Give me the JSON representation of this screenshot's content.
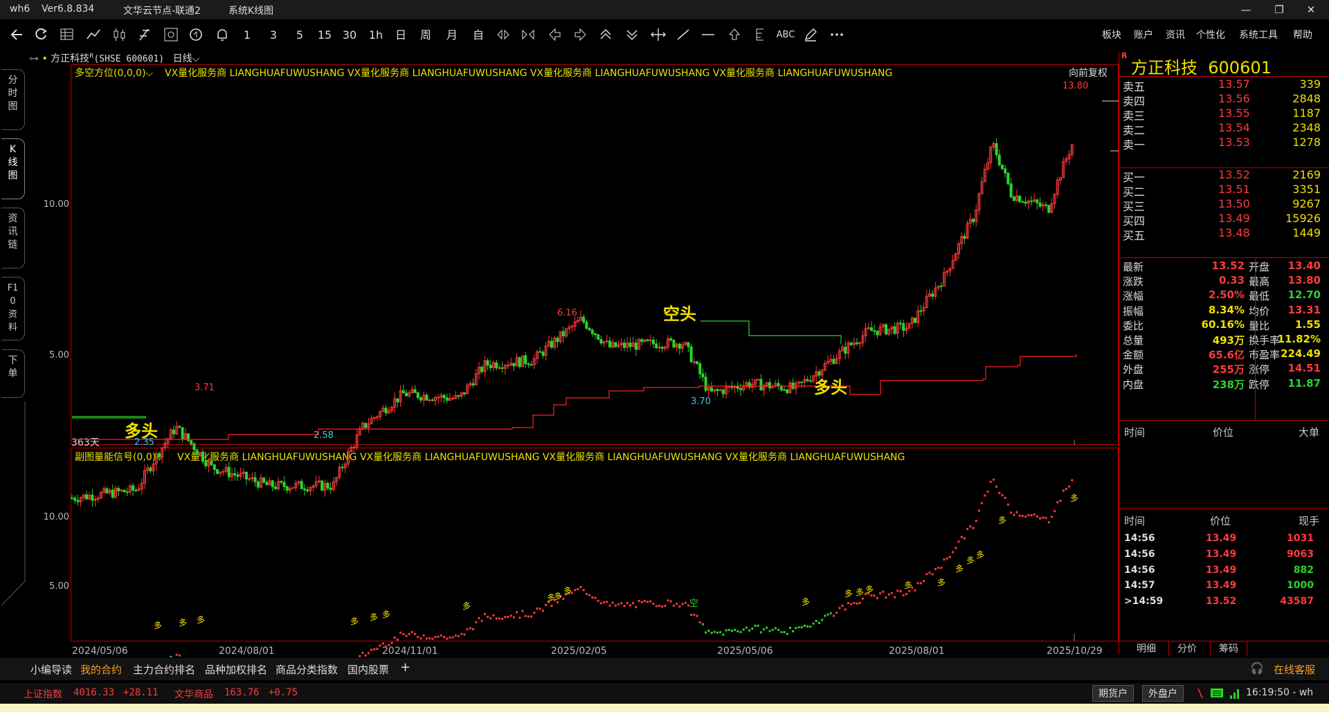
{
  "titlebar": {
    "app": "wh6",
    "version": "Ver6.8.834",
    "server": "文华云节点-联通2",
    "view": "系统K线图",
    "minimize": "—",
    "restore": "❐",
    "close": "✕"
  },
  "toolbar": {
    "periods": [
      "1",
      "3",
      "5",
      "15",
      "30",
      "1h",
      "日",
      "周",
      "月",
      "自"
    ],
    "menu": [
      "板块",
      "账户",
      "资讯",
      "个性化",
      "系统工具",
      "帮助"
    ],
    "abc": "ABC"
  },
  "left_tabs": [
    "分时图",
    "K线图",
    "资讯链",
    "F10资料",
    "下单"
  ],
  "chart_header": {
    "name": "方正科技",
    "r_mark": "R",
    "code": "(SHSE 600601)",
    "period": "日线",
    "adjust": "向前复权"
  },
  "main_indicator": {
    "title": "多空方位(0,0,0)",
    "ad": "VX量化服务商  LIANGHUAFUWUSHANG  VX量化服务商  LIANGHUAFUWUSHANG  VX量化服务商  LIANGHUAFUWUSHANG  VX量化服务商  LIANGHUAFUWUSHANG",
    "days": "363天",
    "label_short": "空头",
    "label_long1": "多头",
    "label_long2": "多头"
  },
  "sub_indicator": {
    "title": "副图量能信号(0,0)",
    "ad": "VX量化服务商  LIANGHUAFUWUSHANG  VX量化服务商  LIANGHUAFUWUSHANG  VX量化服务商  LIANGHUAFUWUSHANG  VX量化服务商  LIANGHUAFUWUSHANG",
    "signal_long": "多",
    "signal_short": "空"
  },
  "chart_data": {
    "type": "candlestick",
    "x_ticks": [
      "2024/05/06",
      "2024/08/01",
      "2024/11/01",
      "2025/02/05",
      "2025/05/06",
      "2025/08/01",
      "2025/10/29"
    ],
    "main_y_ticks": [
      "10.00",
      "5.00"
    ],
    "sub_y_ticks": [
      "10.00",
      "5.00"
    ],
    "annotations": [
      "13.80",
      "6.16",
      "3.71",
      "3.70",
      "2.58",
      "2.35"
    ],
    "close_path": [
      [
        "2024/05/06",
        2.6
      ],
      [
        "2024/06/10",
        2.7
      ],
      [
        "2024/07/01",
        3.6
      ],
      [
        "2024/07/20",
        3.0
      ],
      [
        "2024/08/20",
        2.75
      ],
      [
        "2024/09/24",
        2.75
      ],
      [
        "2024/10/10",
        3.6
      ],
      [
        "2024/11/01",
        4.2
      ],
      [
        "2024/12/01",
        4.1
      ],
      [
        "2024/12/15",
        4.8
      ],
      [
        "2025/01/10",
        4.9
      ],
      [
        "2025/02/05",
        5.9
      ],
      [
        "2025/02/20",
        5.2
      ],
      [
        "2025/03/20",
        5.3
      ],
      [
        "2025/04/01",
        5.3
      ],
      [
        "2025/04/15",
        4.2
      ],
      [
        "2025/05/06",
        4.4
      ],
      [
        "2025/06/01",
        4.3
      ],
      [
        "2025/06/20",
        4.9
      ],
      [
        "2025/07/10",
        5.6
      ],
      [
        "2025/08/01",
        5.7
      ],
      [
        "2025/08/20",
        7.2
      ],
      [
        "2025/09/05",
        9.5
      ],
      [
        "2025/09/15",
        13.2
      ],
      [
        "2025/09/25",
        10.5
      ],
      [
        "2025/10/15",
        9.8
      ],
      [
        "2025/10/29",
        13.52
      ]
    ]
  },
  "quote": {
    "name": "方正科技",
    "code": "600601",
    "asks": [
      {
        "label": "卖五",
        "price": "13.57",
        "vol": "339"
      },
      {
        "label": "卖四",
        "price": "13.56",
        "vol": "2848"
      },
      {
        "label": "卖三",
        "price": "13.55",
        "vol": "1187"
      },
      {
        "label": "卖二",
        "price": "13.54",
        "vol": "2348"
      },
      {
        "label": "卖一",
        "price": "13.53",
        "vol": "1278"
      }
    ],
    "bids": [
      {
        "label": "买一",
        "price": "13.52",
        "vol": "2169"
      },
      {
        "label": "买二",
        "price": "13.51",
        "vol": "3351"
      },
      {
        "label": "买三",
        "price": "13.50",
        "vol": "9267"
      },
      {
        "label": "买四",
        "price": "13.49",
        "vol": "15926"
      },
      {
        "label": "买五",
        "price": "13.48",
        "vol": "1449"
      }
    ],
    "stats": [
      {
        "l1": "最新",
        "v1": "13.52",
        "c1": "#ff3b3b",
        "l2": "开盘",
        "v2": "13.40",
        "c2": "#ff3b3b"
      },
      {
        "l1": "涨跌",
        "v1": "0.33",
        "c1": "#ff3b3b",
        "l2": "最高",
        "v2": "13.80",
        "c2": "#ff3b3b"
      },
      {
        "l1": "涨幅",
        "v1": "2.50%",
        "c1": "#ff3b3b",
        "l2": "最低",
        "v2": "12.70",
        "c2": "#2bd42b"
      },
      {
        "l1": "振幅",
        "v1": "8.34%",
        "c1": "#f0e000",
        "l2": "均价",
        "v2": "13.31",
        "c2": "#ff3b3b"
      },
      {
        "l1": "委比",
        "v1": "60.16%",
        "c1": "#f0e000",
        "l2": "量比",
        "v2": "1.55",
        "c2": "#f0e000"
      },
      {
        "l1": "总量",
        "v1": "493万",
        "c1": "#f0e000",
        "l2": "换手率",
        "v2": "11.82%",
        "c2": "#f0e000"
      },
      {
        "l1": "金额",
        "v1": "65.6亿",
        "c1": "#ff3b3b",
        "l2": "市盈率",
        "v2": "224.49",
        "c2": "#f0e000"
      },
      {
        "l1": "外盘",
        "v1": "255万",
        "c1": "#ff3b3b",
        "l2": "涨停",
        "v2": "14.51",
        "c2": "#ff3b3b"
      },
      {
        "l1": "内盘",
        "v1": "238万",
        "c1": "#2bd42b",
        "l2": "跌停",
        "v2": "11.87",
        "c2": "#2bd42b"
      }
    ],
    "big_order_header": [
      "时间",
      "价位",
      "大单"
    ],
    "ticks_header": [
      "时间",
      "价位",
      "现手"
    ],
    "ticks": [
      {
        "time": "14:56",
        "price": "13.49",
        "vol": "1031",
        "color": "#ff3b3b"
      },
      {
        "time": "14:56",
        "price": "13.49",
        "vol": "9063",
        "color": "#ff3b3b"
      },
      {
        "time": "14:56",
        "price": "13.49",
        "vol": "882",
        "color": "#2bd42b"
      },
      {
        "time": "14:57",
        "price": "13.49",
        "vol": "1000",
        "color": "#2bd42b"
      },
      {
        "time": ">14:59",
        "price": "13.52",
        "vol": "43587",
        "color": "#ff3b3b"
      }
    ],
    "bottom_tabs": [
      "明细",
      "分价",
      "筹码"
    ]
  },
  "bottom_tabs": [
    "小编导读",
    "我的合约",
    "主力合约排名",
    "品种加权排名",
    "商品分类指数",
    "国内股票",
    "+"
  ],
  "customer_service": "在线客服",
  "status": {
    "index1_name": "上证指数",
    "index1_value": "4016.33",
    "index1_change": "+28.11",
    "index2_name": "文华商品",
    "index2_value": "163.76",
    "index2_change": "+0.75",
    "btn_futures": "期货户",
    "btn_external": "外盘户",
    "clock": "16:19:50 - wh"
  },
  "colors": {
    "up": "#ff3b3b",
    "down": "#2bd42b",
    "accent": "#f0e000",
    "frame": "#c00000"
  }
}
